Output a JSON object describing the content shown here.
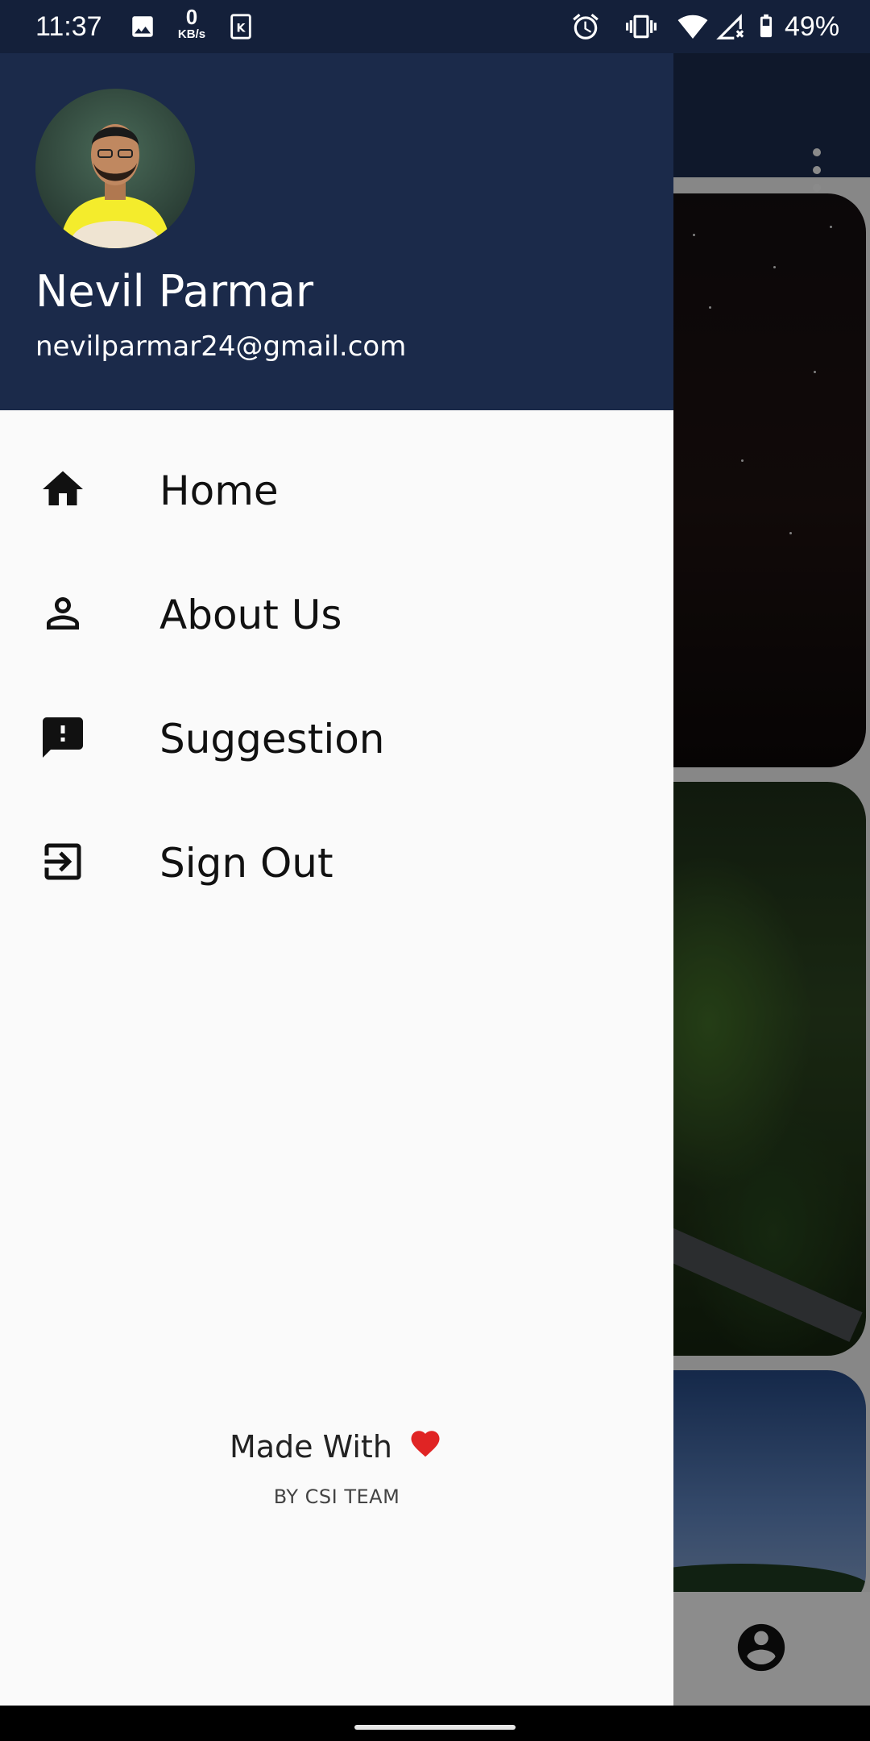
{
  "status_bar": {
    "time": "11:37",
    "data_speed_value": "0",
    "data_speed_unit": "KB/s",
    "battery_percent": "49%",
    "icons": [
      "image-icon",
      "keyboard-icon",
      "alarm-icon",
      "vibrate-icon",
      "wifi-icon",
      "signal-no-data-icon",
      "battery-icon"
    ]
  },
  "drawer": {
    "user": {
      "name": "Nevil Parmar",
      "email": "nevilparmar24@gmail.com"
    },
    "menu": [
      {
        "label": "Home",
        "icon": "home-icon"
      },
      {
        "label": "About Us",
        "icon": "person-icon"
      },
      {
        "label": "Suggestion",
        "icon": "feedback-icon"
      },
      {
        "label": "Sign Out",
        "icon": "exit-icon"
      }
    ],
    "footer": {
      "made_with": "Made With",
      "credit": "BY CSI TEAM",
      "heart_icon": "heart-icon"
    }
  },
  "background_app": {
    "overflow_icon": "more-vert-icon",
    "bottom_icon": "account-icon"
  },
  "colors": {
    "header": "#1b2a4a",
    "status_bar": "#14203a",
    "drawer_bg": "#fafafa",
    "heart": "#e02424"
  }
}
